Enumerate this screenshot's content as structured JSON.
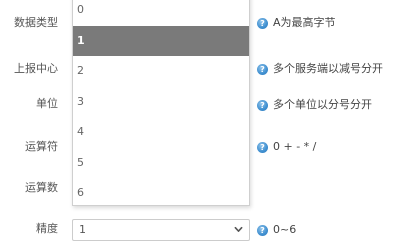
{
  "fields": [
    {
      "label": "数据类型",
      "hint": "A为最高字节"
    },
    {
      "label": "上报中心",
      "hint": "多个服务端以减号分开"
    },
    {
      "label": "单位",
      "hint": "多个单位以分号分开"
    },
    {
      "label": "运算符",
      "hint": "0 + - * /"
    },
    {
      "label": "运算数",
      "hint": ""
    },
    {
      "label": "精度",
      "hint": "0~6"
    }
  ],
  "precision_select": {
    "value": "1",
    "options": [
      "0",
      "1",
      "2",
      "3",
      "4",
      "5",
      "6"
    ],
    "selected_index": 1
  },
  "icons": {
    "hint_icon": "question-circle-icon",
    "select_arrow": "chevron-down-icon"
  },
  "colors": {
    "selected_option_bg": "#7a7a7a",
    "hint_icon": "#3f8fd0"
  }
}
